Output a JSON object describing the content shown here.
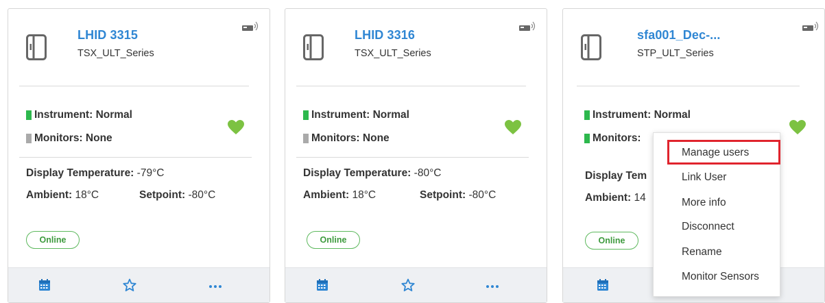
{
  "cards": [
    {
      "name": "LHID 3315",
      "model": "TSX_ULT_Series",
      "instrument_label": "Instrument:",
      "instrument_value": "Normal",
      "instrument_color": "#2db84d",
      "monitors_label": "Monitors:",
      "monitors_value": "None",
      "monitors_color": "#aaaaaa",
      "display_temp_label": "Display Temperature:",
      "display_temp_value": "-79°C",
      "ambient_label": "Ambient:",
      "ambient_value": "18°C",
      "setpoint_label": "Setpoint:",
      "setpoint_value": "-80°C",
      "status": "Online"
    },
    {
      "name": "LHID 3316",
      "model": "TSX_ULT_Series",
      "instrument_label": "Instrument:",
      "instrument_value": "Normal",
      "instrument_color": "#2db84d",
      "monitors_label": "Monitors:",
      "monitors_value": "None",
      "monitors_color": "#aaaaaa",
      "display_temp_label": "Display Temperature:",
      "display_temp_value": "-80°C",
      "ambient_label": "Ambient:",
      "ambient_value": "18°C",
      "setpoint_label": "Setpoint:",
      "setpoint_value": "-80°C",
      "status": "Online"
    },
    {
      "name": "sfa001_Dec-...",
      "model": "STP_ULT_Series",
      "instrument_label": "Instrument:",
      "instrument_value": "Normal",
      "instrument_color": "#2db84d",
      "monitors_label": "Monitors:",
      "monitors_color": "#2db84d",
      "display_temp_label": "Display Tem",
      "ambient_label": "Ambient:",
      "ambient_value": "14",
      "status": "Online"
    }
  ],
  "context_menu": {
    "items": [
      "Manage users",
      "Link User",
      "More info",
      "Disconnect",
      "Rename",
      "Monitor Sensors"
    ],
    "highlighted": "Manage users"
  },
  "icons": {
    "device": "fridge-icon",
    "connection": "wireless-signal-icon",
    "health": "heart-icon",
    "footer": [
      "calendar-icon",
      "star-icon",
      "more-options-icon"
    ]
  },
  "colors": {
    "accent": "#2f86d3",
    "healthy": "#7cc242",
    "online": "#5cb85c",
    "highlight_box": "#e0242d"
  }
}
